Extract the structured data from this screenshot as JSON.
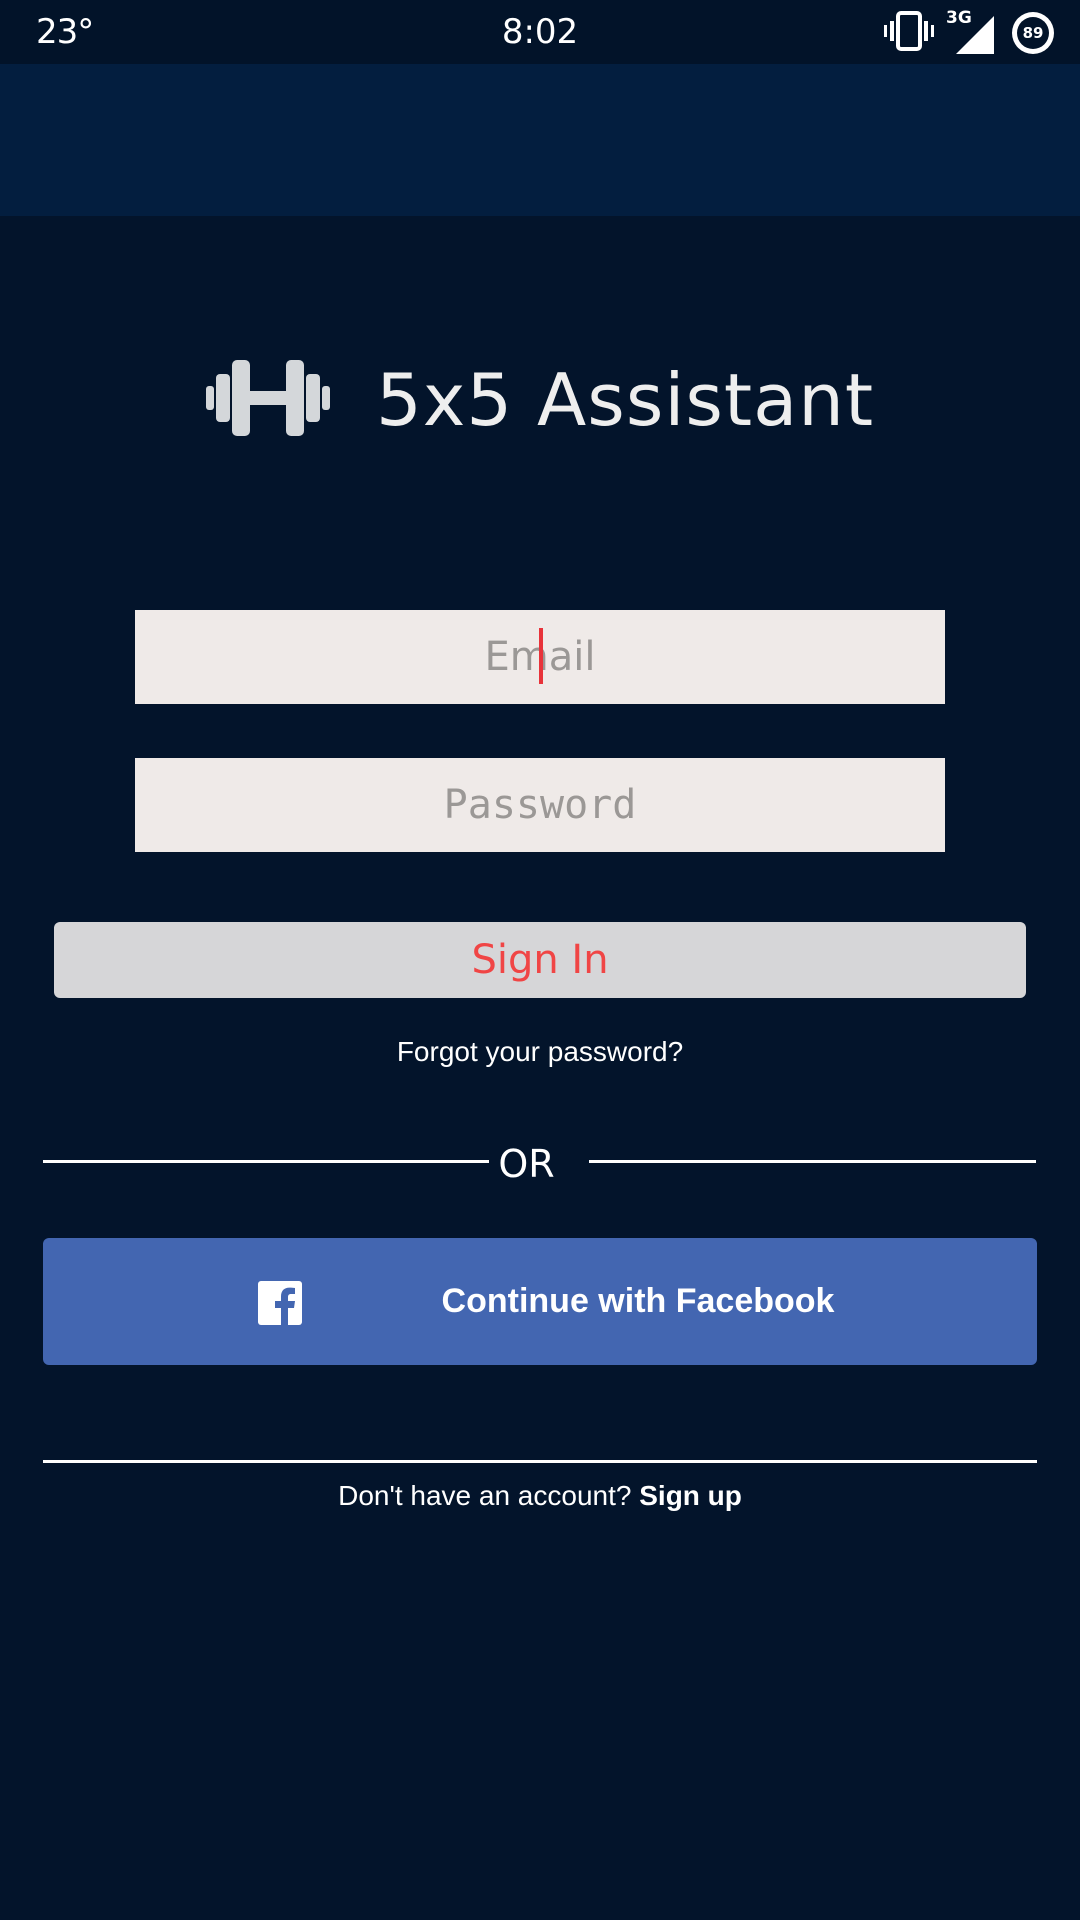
{
  "status_bar": {
    "temperature": "23°",
    "time": "8:02",
    "network": "3G",
    "battery": "89",
    "icons": [
      "vibrate-icon",
      "cell-signal-icon",
      "battery-icon"
    ]
  },
  "app": {
    "title": "5x5 Assistant",
    "logo_icon": "dumbbell-icon"
  },
  "form": {
    "email_placeholder": "Email",
    "email_value": "",
    "password_placeholder": "Password",
    "password_value": "",
    "sign_in_label": "Sign In",
    "forgot_password_label": "Forgot your password?"
  },
  "divider": {
    "or_label": "OR"
  },
  "facebook": {
    "label": "Continue with Facebook",
    "icon": "facebook-icon",
    "color": "#4366b1"
  },
  "signup": {
    "prompt": "Don't have an account?",
    "link_label": "Sign up"
  },
  "colors": {
    "background": "#03142b",
    "app_bar": "#031e3f",
    "accent_red": "#f04545",
    "input_bg": "#efeae8",
    "button_bg": "#d6d6d8"
  }
}
